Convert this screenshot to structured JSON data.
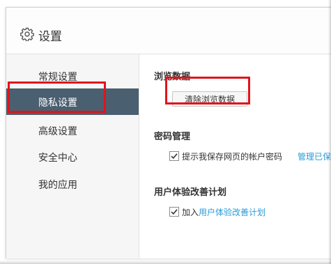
{
  "header": {
    "title": "设置",
    "icon": "gear-icon"
  },
  "sidebar": {
    "items": [
      {
        "label": "常规设置",
        "active": false
      },
      {
        "label": "隐私设置",
        "active": true
      },
      {
        "label": "高级设置",
        "active": false
      },
      {
        "label": "安全中心",
        "active": false
      },
      {
        "label": "我的应用",
        "active": false
      }
    ]
  },
  "content": {
    "browse_data": {
      "title": "浏览数据",
      "clear_button": "清除浏览数据"
    },
    "password": {
      "title": "密码管理",
      "checkbox_label": "提示我保存网页的帐户密码",
      "checked": true,
      "manage_link": "管理已保"
    },
    "ux_plan": {
      "title": "用户体验改善计划",
      "checkbox_prefix": "加入",
      "checkbox_link": "用户体验改善计划",
      "checked": true
    }
  },
  "colors": {
    "active_nav_bg": "#4a5f70",
    "link": "#2a9bd8",
    "highlight": "#e0141b"
  }
}
